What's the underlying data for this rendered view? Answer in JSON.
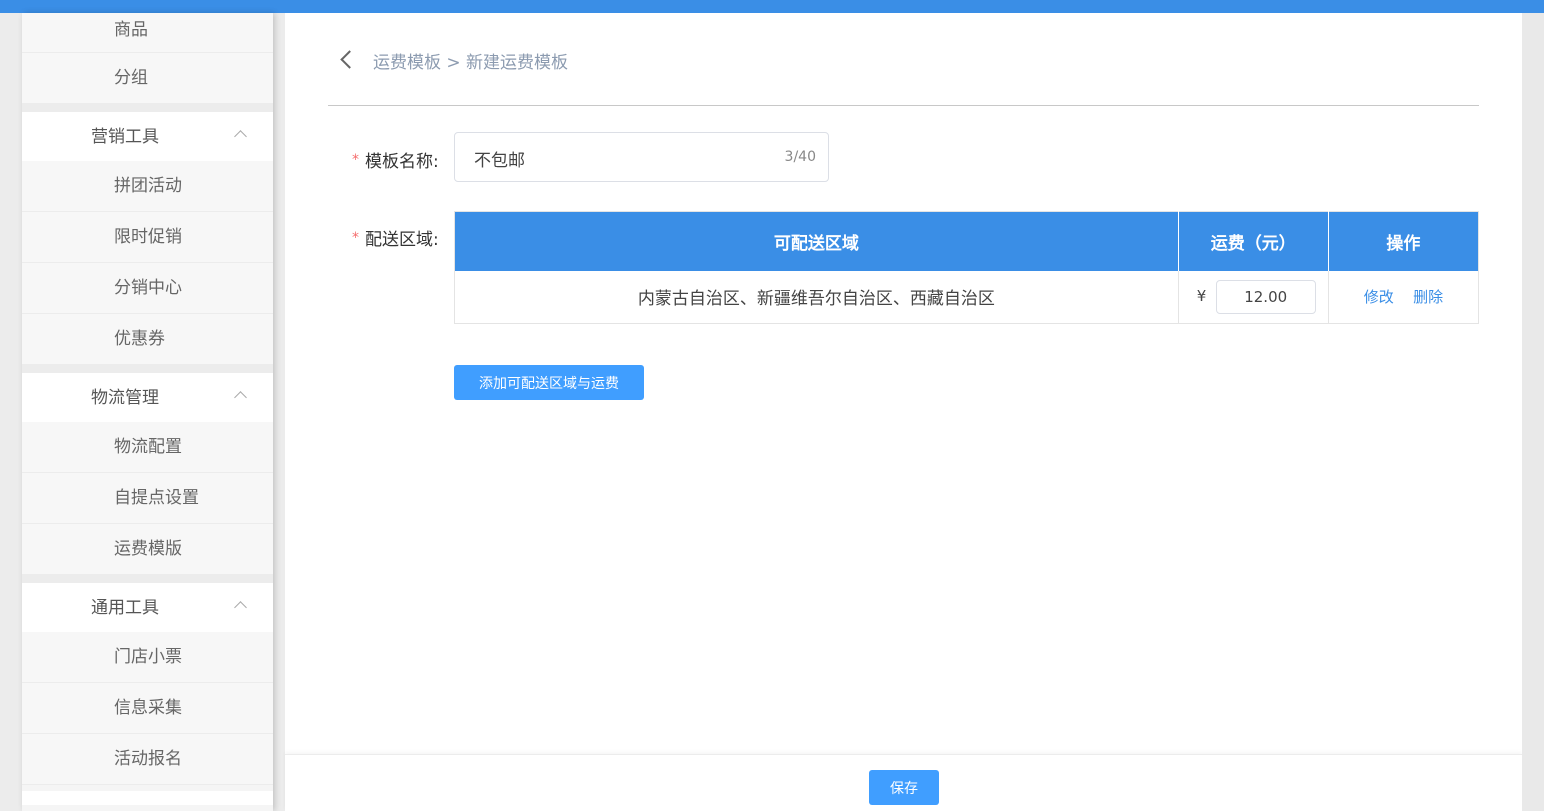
{
  "sidebar": {
    "top_items": [
      "商品",
      "分组"
    ],
    "groups": [
      {
        "title": "营销工具",
        "items": [
          "拼团活动",
          "限时促销",
          "分销中心",
          "优惠券"
        ]
      },
      {
        "title": "物流管理",
        "items": [
          "物流配置",
          "自提点设置",
          "运费模版"
        ]
      },
      {
        "title": "通用工具",
        "items": [
          "门店小票",
          "信息采集",
          "活动报名"
        ]
      }
    ]
  },
  "header": {
    "breadcrumb": "运费模板 > 新建运费模板"
  },
  "form": {
    "name_label": "模板名称:",
    "name_value": "不包邮",
    "name_count": "3/40",
    "zone_label": "配送区域:",
    "required_mark": "*"
  },
  "table": {
    "headers": [
      "可配送区域",
      "运费（元）",
      "操作"
    ],
    "rows": [
      {
        "zones": "内蒙古自治区、新疆维吾尔自治区、西藏自治区",
        "currency": "¥",
        "fee": "12.00",
        "edit": "修改",
        "delete": "删除"
      }
    ]
  },
  "buttons": {
    "add_zone": "添加可配送区域与运费",
    "save": "保存"
  },
  "colors": {
    "primary": "#3a8ee6",
    "button": "#409eff",
    "required": "#f56c6c"
  }
}
